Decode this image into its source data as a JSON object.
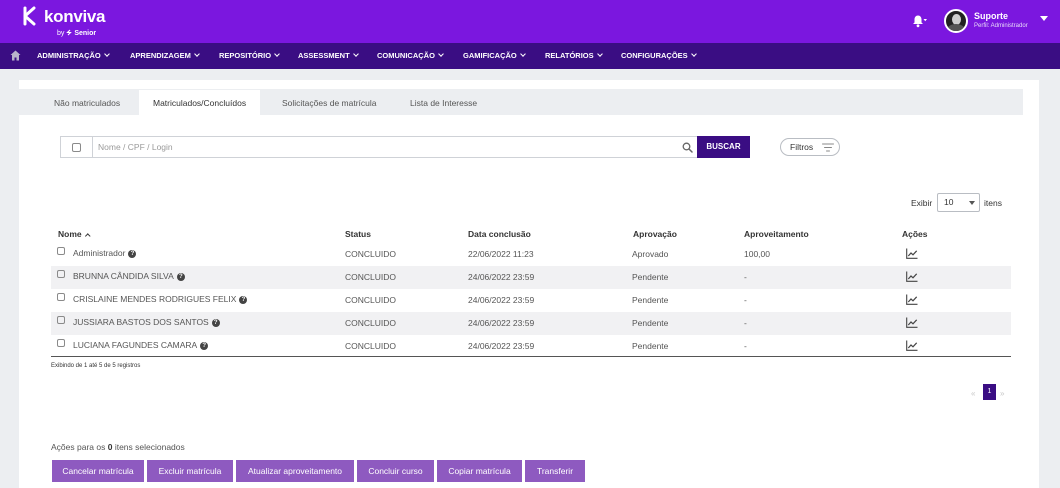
{
  "header": {
    "brand": "konviva",
    "brand_by": "by",
    "brand_company": "Senior",
    "user_name": "Suporte",
    "user_role": "Perfil: Administrador"
  },
  "nav": {
    "items": [
      {
        "label": "ADMINISTRAÇÃO"
      },
      {
        "label": "APRENDIZAGEM"
      },
      {
        "label": "REPOSITÓRIO"
      },
      {
        "label": "ASSESSMENT"
      },
      {
        "label": "COMUNICAÇÃO"
      },
      {
        "label": "GAMIFICAÇÃO"
      },
      {
        "label": "RELATÓRIOS"
      },
      {
        "label": "CONFIGURAÇÕES"
      }
    ]
  },
  "tabs": [
    {
      "label": "Não matriculados",
      "active": false
    },
    {
      "label": "Matriculados/Concluídos",
      "active": true
    },
    {
      "label": "Solicitações de matrícula",
      "active": false
    },
    {
      "label": "Lista de Interesse",
      "active": false
    }
  ],
  "search": {
    "placeholder": "Nome / CPF / Login",
    "value": "",
    "button_label": "BUSCAR",
    "filters_label": "Filtros"
  },
  "page_size": {
    "label_before": "Exibir",
    "value": "10",
    "label_after": "itens"
  },
  "table": {
    "columns": [
      "Nome",
      "Status",
      "Data conclusão",
      "Aprovação",
      "Aproveitamento",
      "Ações"
    ],
    "rows": [
      {
        "nome": "Administrador",
        "status": "CONCLUIDO",
        "data": "22/06/2022 11:23",
        "aprovacao": "Aprovado",
        "aproveitamento": "100,00"
      },
      {
        "nome": "BRUNNA CÂNDIDA SILVA",
        "status": "CONCLUIDO",
        "data": "24/06/2022 23:59",
        "aprovacao": "Pendente",
        "aproveitamento": "-"
      },
      {
        "nome": "CRISLAINE MENDES RODRIGUES FELIX",
        "status": "CONCLUIDO",
        "data": "24/06/2022 23:59",
        "aprovacao": "Pendente",
        "aproveitamento": "-"
      },
      {
        "nome": "JUSSIARA BASTOS DOS SANTOS",
        "status": "CONCLUIDO",
        "data": "24/06/2022 23:59",
        "aprovacao": "Pendente",
        "aproveitamento": "-"
      },
      {
        "nome": "LUCIANA FAGUNDES CAMARA",
        "status": "CONCLUIDO",
        "data": "24/06/2022 23:59",
        "aprovacao": "Pendente",
        "aproveitamento": "-"
      }
    ],
    "footer": "Exibindo de 1 até 5 de 5 registros"
  },
  "pagination": {
    "prev": "«",
    "current": "1",
    "next": "»"
  },
  "actions": {
    "label_prefix": "Ações para os",
    "selected_count": "0",
    "label_suffix": "itens selecionados",
    "buttons": [
      {
        "label": "Cancelar matrícula"
      },
      {
        "label": "Excluir matrícula"
      },
      {
        "label": "Atualizar aproveitamento"
      },
      {
        "label": "Concluir curso"
      },
      {
        "label": "Copiar matrícula"
      },
      {
        "label": "Transferir"
      }
    ]
  },
  "colors": {
    "header_bg": "#7b17df",
    "nav_bg": "#3a0d83",
    "primary_button": "#3a0d83",
    "action_button": "#8e5ac0"
  },
  "icons": {
    "home": "home-icon",
    "bell": "bell-icon",
    "search": "search-icon",
    "filter": "filter-icon",
    "help": "help-circle-icon",
    "chart": "chart-line-icon"
  }
}
